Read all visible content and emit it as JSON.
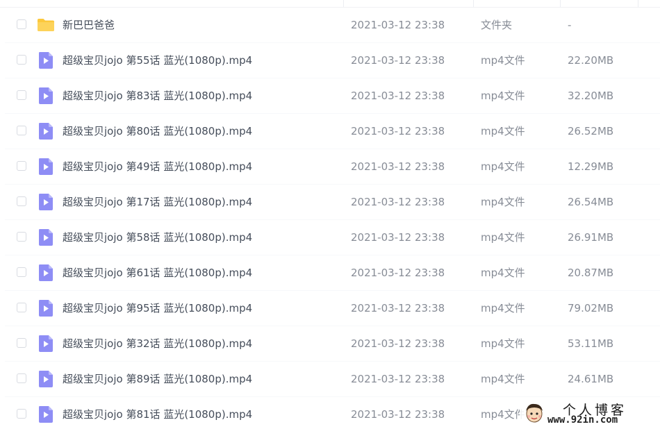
{
  "colors": {
    "folder_icon": "#fcc83c",
    "video_icon": "#8e8df5",
    "name_text": "#454d5a",
    "meta_text": "#878c96"
  },
  "files": [
    {
      "icon": "folder-icon",
      "name": "新巴巴爸爸",
      "date": "2021-03-12 23:38",
      "type": "文件夹",
      "size": "-"
    },
    {
      "icon": "video-file-icon",
      "name": "超级宝贝jojo 第55话 蓝光(1080p).mp4",
      "date": "2021-03-12 23:38",
      "type": "mp4文件",
      "size": "22.20MB"
    },
    {
      "icon": "video-file-icon",
      "name": "超级宝贝jojo 第83话 蓝光(1080p).mp4",
      "date": "2021-03-12 23:38",
      "type": "mp4文件",
      "size": "32.20MB"
    },
    {
      "icon": "video-file-icon",
      "name": "超级宝贝jojo 第80话 蓝光(1080p).mp4",
      "date": "2021-03-12 23:38",
      "type": "mp4文件",
      "size": "26.52MB"
    },
    {
      "icon": "video-file-icon",
      "name": "超级宝贝jojo 第49话 蓝光(1080p).mp4",
      "date": "2021-03-12 23:38",
      "type": "mp4文件",
      "size": "12.29MB"
    },
    {
      "icon": "video-file-icon",
      "name": "超级宝贝jojo 第17话 蓝光(1080p).mp4",
      "date": "2021-03-12 23:38",
      "type": "mp4文件",
      "size": "26.54MB"
    },
    {
      "icon": "video-file-icon",
      "name": "超级宝贝jojo 第58话 蓝光(1080p).mp4",
      "date": "2021-03-12 23:38",
      "type": "mp4文件",
      "size": "26.91MB"
    },
    {
      "icon": "video-file-icon",
      "name": "超级宝贝jojo 第61话 蓝光(1080p).mp4",
      "date": "2021-03-12 23:38",
      "type": "mp4文件",
      "size": "20.87MB"
    },
    {
      "icon": "video-file-icon",
      "name": "超级宝贝jojo 第95话 蓝光(1080p).mp4",
      "date": "2021-03-12 23:38",
      "type": "mp4文件",
      "size": "79.02MB"
    },
    {
      "icon": "video-file-icon",
      "name": "超级宝贝jojo 第32话 蓝光(1080p).mp4",
      "date": "2021-03-12 23:38",
      "type": "mp4文件",
      "size": "53.11MB"
    },
    {
      "icon": "video-file-icon",
      "name": "超级宝贝jojo 第89话 蓝光(1080p).mp4",
      "date": "2021-03-12 23:38",
      "type": "mp4文件",
      "size": "24.61MB"
    },
    {
      "icon": "video-file-icon",
      "name": "超级宝贝jojo 第81话 蓝光(1080p).mp4",
      "date": "2021-03-12 23:38",
      "type": "mp4文件",
      "size": ""
    }
  ],
  "watermark": {
    "title": "个人博客",
    "url": "www.92in.com",
    "icon": "avatar-cartoon-icon"
  }
}
